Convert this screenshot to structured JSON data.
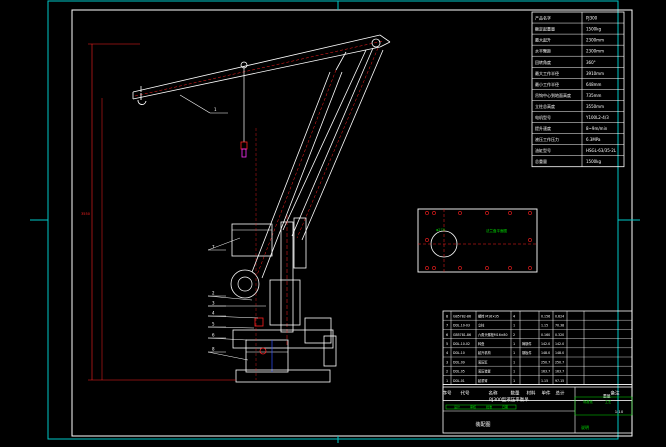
{
  "colors": {
    "background": "#000000",
    "frame": "#00c8c8",
    "white": "#ffffff",
    "red": "#ff2020",
    "blue": "#3050ff",
    "magenta": "#ff30ff",
    "green": "#00e000",
    "yellow": "#e0e000"
  },
  "specs": {
    "rows": [
      {
        "label": "产品名字",
        "value": "PJ300"
      },
      {
        "label": "额定起重量",
        "value": "1500kg"
      },
      {
        "label": "最大起升",
        "value": "2300mm"
      },
      {
        "label": "水平臂距",
        "value": "2300mm"
      },
      {
        "label": "回转角度",
        "value": "360°"
      },
      {
        "label": "最大工作半径",
        "value": "3910mm"
      },
      {
        "label": "最小工作半径",
        "value": "648mm"
      },
      {
        "label": "吊钩中心到地面高度",
        "value": "735mm"
      },
      {
        "label": "立柱总高度",
        "value": "3550mm"
      },
      {
        "label": "电机型号",
        "value": "Y100L2-4/3"
      },
      {
        "label": "提升速度",
        "value": "8~9m/min"
      },
      {
        "label": "液压工作压力",
        "value": "6.3MPa"
      },
      {
        "label": "油缸型号",
        "value": "HSGL-63/35-2L"
      },
      {
        "label": "总重量",
        "value": "1500kg"
      }
    ]
  },
  "plate": {
    "label": "法兰盘平面图",
    "center_label": "φ270"
  },
  "callouts": [
    "1",
    "2",
    "3",
    "4",
    "5",
    "6",
    "7",
    "8"
  ],
  "dimensions": {
    "overall_height": "3550"
  },
  "bom": {
    "rows": [
      {
        "no": "8",
        "code": "GB5782-86",
        "name": "螺栓 M16×35",
        "qty": "4",
        "material": "",
        "weight": "0.156",
        "total": "0.624"
      },
      {
        "no": "7",
        "code": "DDL.10-03",
        "name": "立柱",
        "qty": "1",
        "material": "",
        "weight": "1.15",
        "total": "70.38"
      },
      {
        "no": "6",
        "code": "GB5781-86",
        "name": "六角头螺栓M16×80",
        "qty": "2",
        "material": "",
        "weight": "0.160",
        "total": "0.320"
      },
      {
        "no": "5",
        "code": "DDL.10-02",
        "name": "转盘",
        "qty": "1",
        "material": "铸钢件",
        "weight": "142.0",
        "total": "142.0"
      },
      {
        "no": "4",
        "code": "DDL.10",
        "name": "起升机构",
        "qty": "1",
        "material": "钢板件",
        "weight": "148.0",
        "total": "148.0"
      },
      {
        "no": "3",
        "code": "DDL.09",
        "name": "液压缸",
        "qty": "1",
        "material": "",
        "weight": "250.7",
        "total": "250.7"
      },
      {
        "no": "2",
        "code": "DDL.05",
        "name": "液压装置",
        "qty": "1",
        "material": "",
        "weight": "163.7",
        "total": "163.7"
      },
      {
        "no": "1",
        "code": "DDL.01",
        "name": "起重臂",
        "qty": "1",
        "material": "",
        "weight": "1.15",
        "total": "97.15"
      }
    ],
    "header": {
      "no": "序号",
      "code": "代号",
      "name": "名称",
      "qty": "数量",
      "material": "材料",
      "weight": "单件",
      "total": "总计",
      "weight_unit": "重量",
      "remark": "备注"
    }
  },
  "title_block": {
    "drawing_title": "PJ300型液压平衡吊",
    "scale": "1:10",
    "sheet_label": "装配图",
    "school": "说明",
    "design": "设计",
    "check": "审核",
    "approve": "批准",
    "std": "标准化",
    "process": "工艺",
    "date": "日期"
  }
}
